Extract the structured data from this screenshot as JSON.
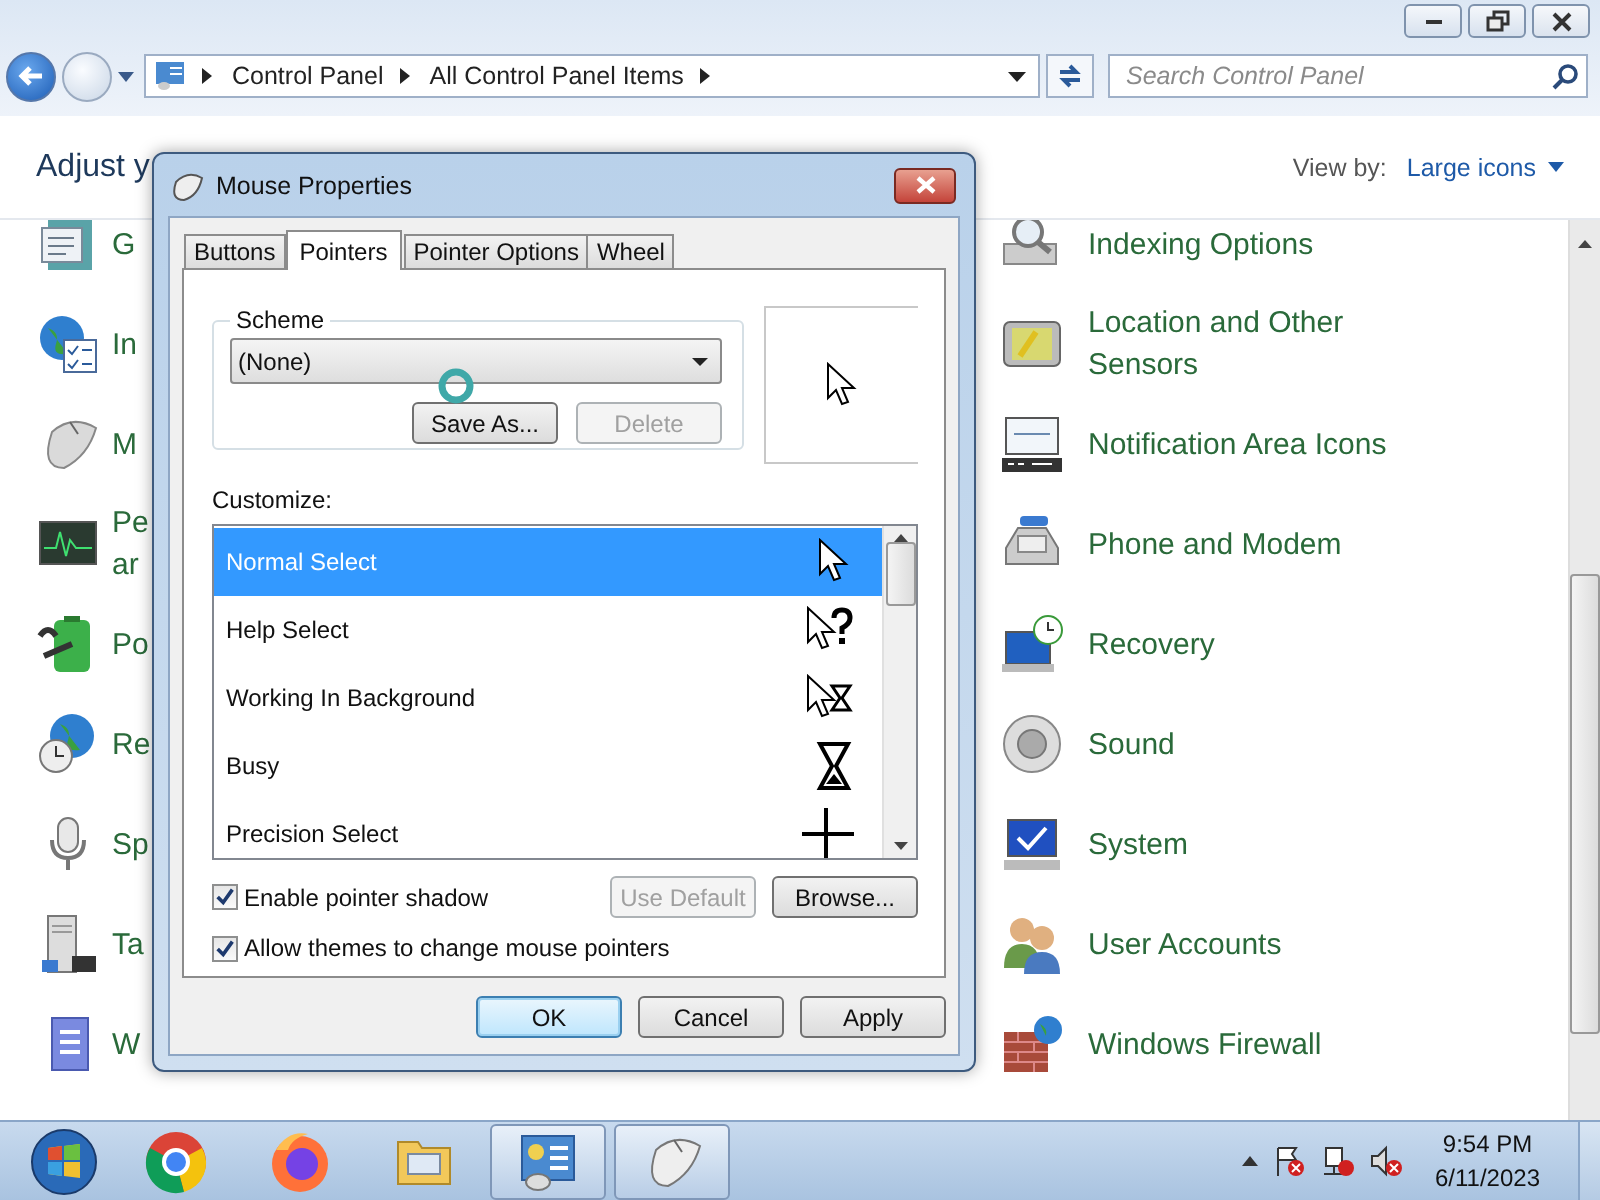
{
  "explorer": {
    "breadcrumb": [
      "Control Panel",
      "All Control Panel Items"
    ],
    "search": {
      "placeholder": "Search Control Panel"
    },
    "heading": "Adjust y",
    "view_by": {
      "label": "View by:",
      "value": "Large icons"
    },
    "items_left": [
      {
        "label": "G"
      },
      {
        "label": "In"
      },
      {
        "label": "M"
      },
      {
        "label": "Pe ar"
      },
      {
        "label": "Po"
      },
      {
        "label": "Re"
      },
      {
        "label": "Sp"
      },
      {
        "label": "Ta"
      },
      {
        "label": "W"
      }
    ],
    "items_right": [
      {
        "label": "Indexing Options"
      },
      {
        "label": "Location and Other Sensors"
      },
      {
        "label": "Notification Area Icons"
      },
      {
        "label": "Phone and Modem"
      },
      {
        "label": "Recovery"
      },
      {
        "label": "Sound"
      },
      {
        "label": "System"
      },
      {
        "label": "User Accounts"
      },
      {
        "label": "Windows Firewall"
      }
    ]
  },
  "dialog": {
    "title": "Mouse Properties",
    "tabs": [
      {
        "label": "Buttons",
        "selected": false
      },
      {
        "label": "Pointers",
        "selected": true
      },
      {
        "label": "Pointer Options",
        "selected": false
      },
      {
        "label": "Wheel",
        "selected": false
      }
    ],
    "scheme": {
      "label": "Scheme",
      "value": "(None)",
      "buttons": [
        {
          "label": "Save As...",
          "disabled": false
        },
        {
          "label": "Delete",
          "disabled": true
        }
      ]
    },
    "customize_label": "Customize:",
    "pointers": [
      {
        "label": "Normal Select",
        "selected": true
      },
      {
        "label": "Help Select",
        "selected": false
      },
      {
        "label": "Working In Background",
        "selected": false
      },
      {
        "label": "Busy",
        "selected": false
      },
      {
        "label": "Precision Select",
        "selected": false
      }
    ],
    "options": [
      {
        "label": "Enable pointer shadow",
        "checked": true
      },
      {
        "label": "Allow themes to change mouse pointers",
        "checked": true
      }
    ],
    "pointer_buttons": [
      {
        "label": "Use Default",
        "disabled": true
      },
      {
        "label": "Browse...",
        "disabled": false
      }
    ],
    "buttons": [
      {
        "label": "OK",
        "default": true
      },
      {
        "label": "Cancel",
        "default": false
      },
      {
        "label": "Apply",
        "default": false
      }
    ]
  },
  "taskbar": {
    "apps": [
      {
        "running": false
      },
      {
        "running": false
      },
      {
        "running": false
      },
      {
        "running": true
      },
      {
        "running": true
      }
    ],
    "clock": {
      "time": "9:54 PM",
      "date": "6/11/2023"
    }
  }
}
